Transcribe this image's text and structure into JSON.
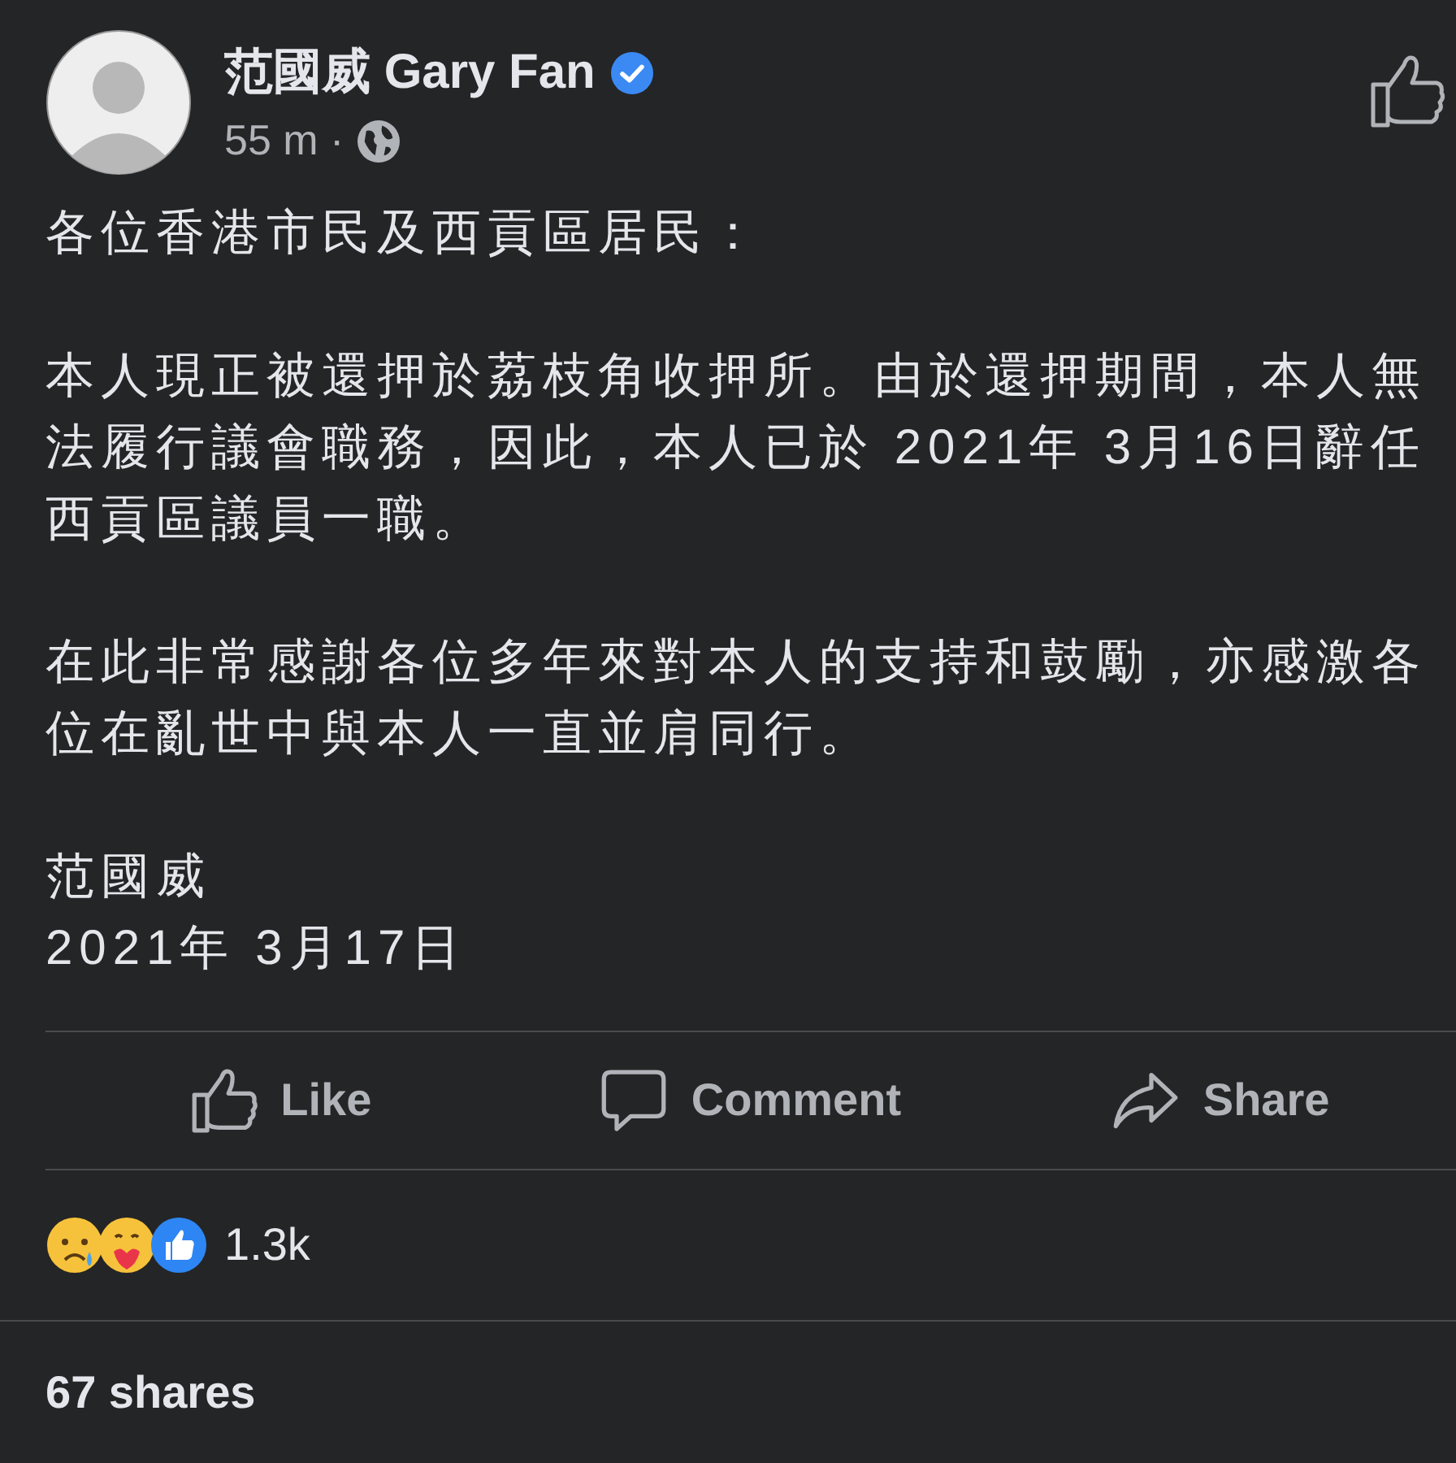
{
  "post": {
    "author": "范國威 Gary Fan",
    "verified": true,
    "time": "55 m ·",
    "public": true,
    "paragraphs": [
      "各位香港市民及西貢區居民：",
      "本人現正被還押於荔枝角收押所。由於還押期間，本人無法履行議會職務，因此，本人已於 2021年 3月16日辭任西貢區議員一職。",
      "在此非常感謝各位多年來對本人的支持和鼓勵，亦感激各位在亂世中與本人一直並肩同行。",
      "范國威\n2021年 3月17日"
    ]
  },
  "actions": [
    {
      "kind": "like",
      "label": "Like"
    },
    {
      "kind": "comment",
      "label": "Comment"
    },
    {
      "kind": "share",
      "label": "Share"
    }
  ],
  "reactions": {
    "count": "1.3k"
  },
  "shares": "67 shares"
}
